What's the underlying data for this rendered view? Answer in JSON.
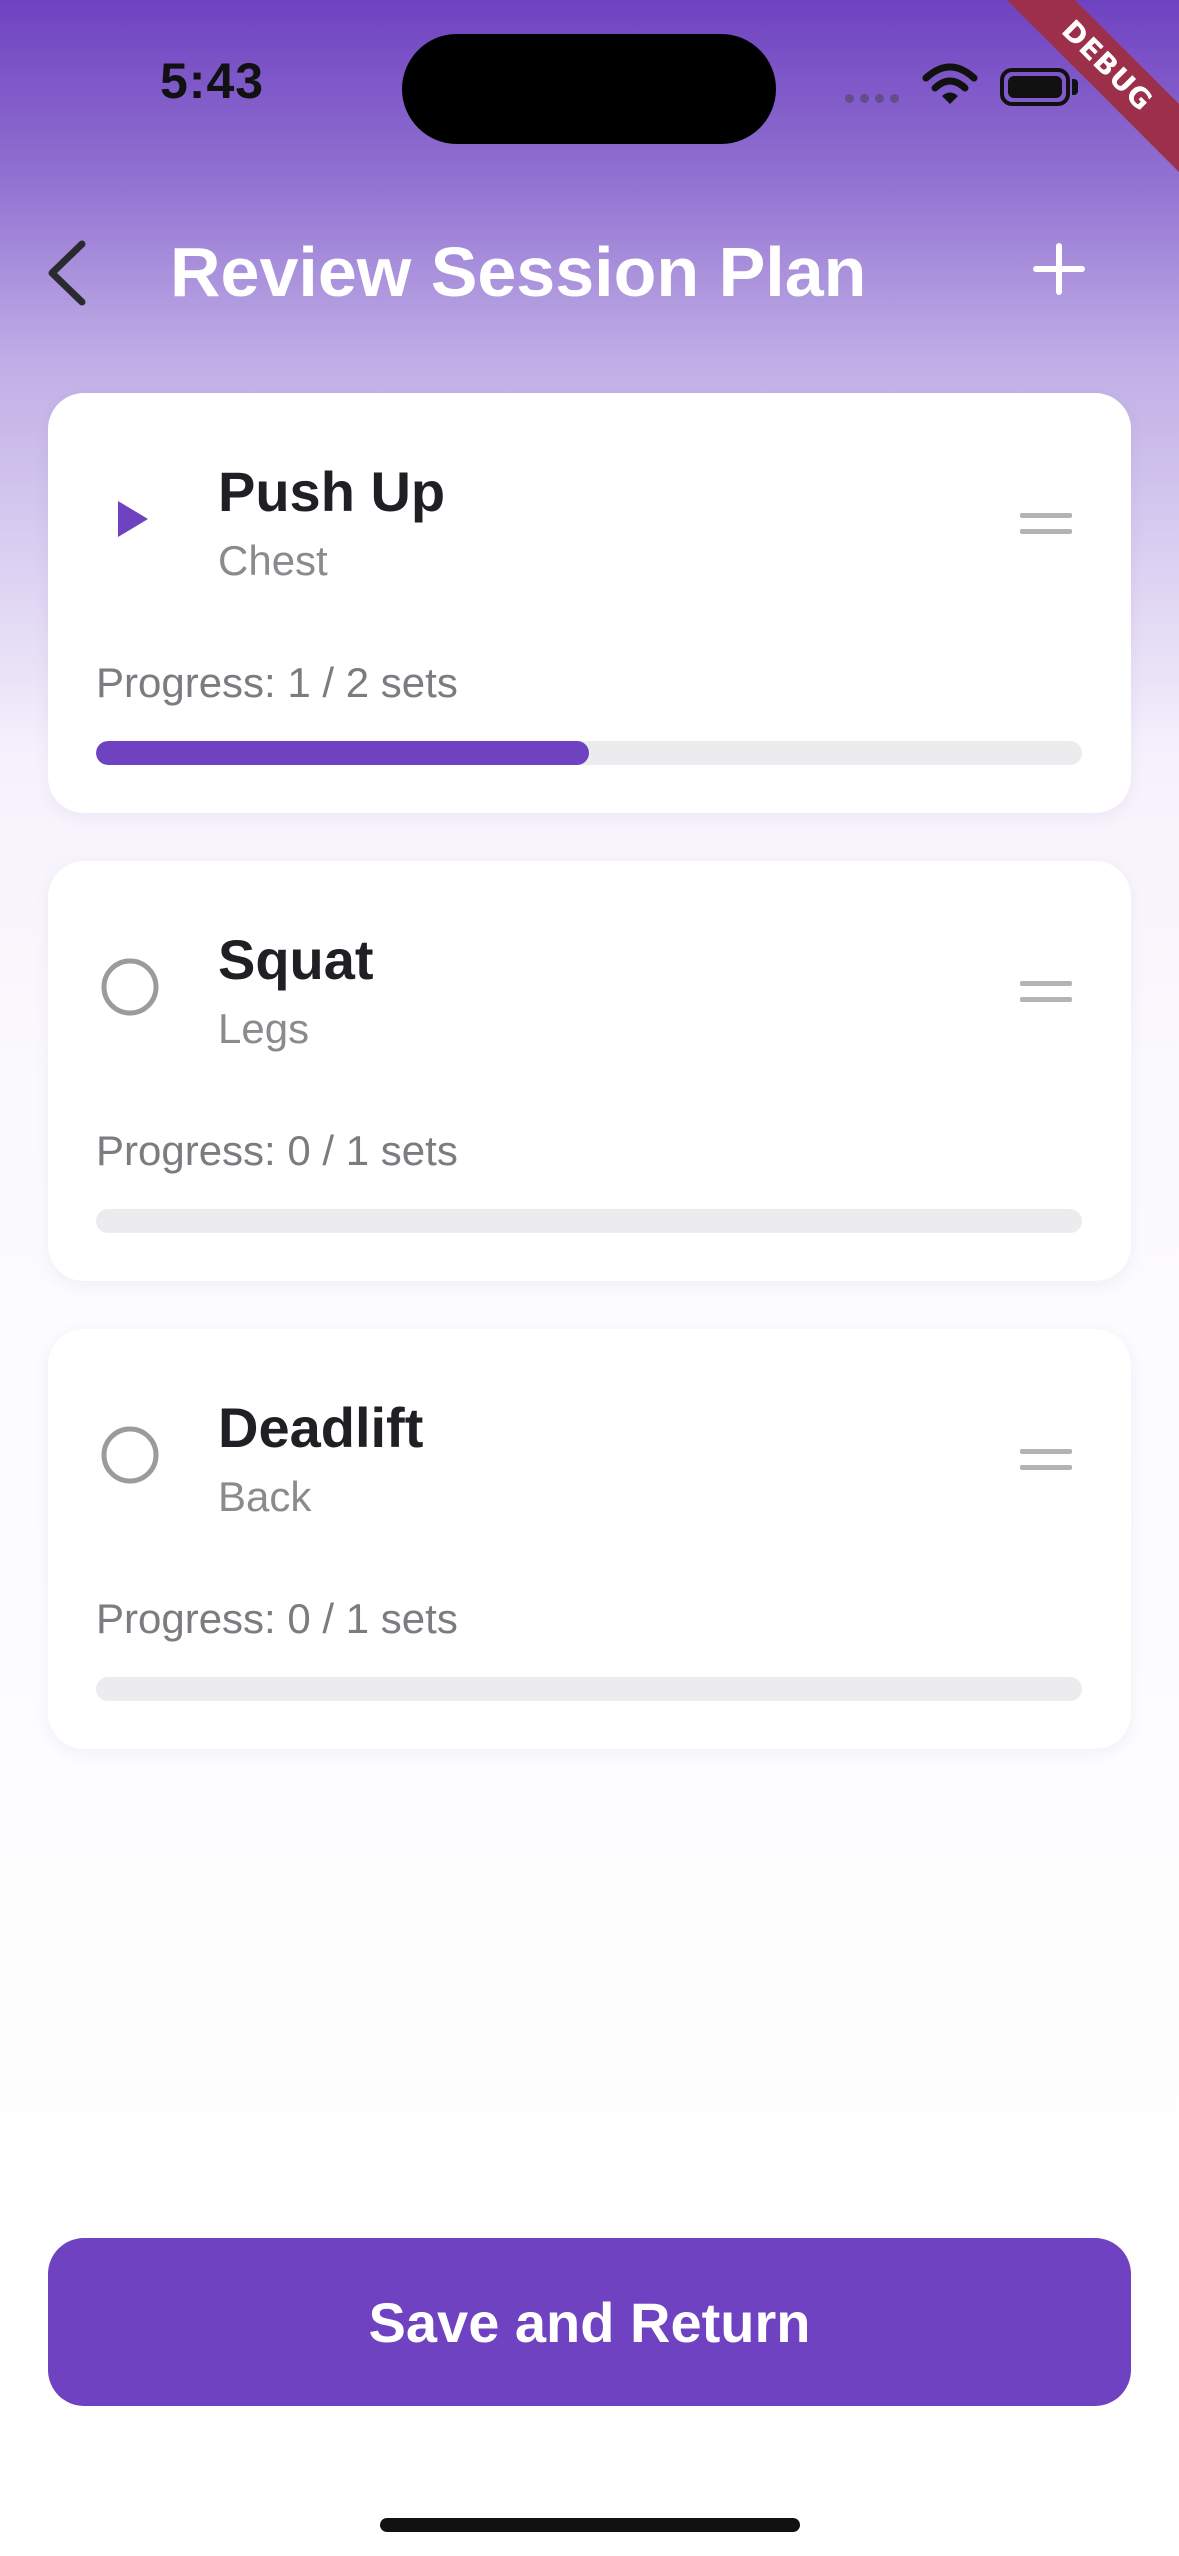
{
  "status_bar": {
    "time": "5:43",
    "debug_label": "DEBUG"
  },
  "header": {
    "title": "Review Session Plan",
    "back_icon": "chevron-left-icon",
    "add_icon": "plus-icon"
  },
  "exercises": [
    {
      "name": "Push Up",
      "group": "Chest",
      "progress_text": "Progress: 1 / 2 sets",
      "completed_sets": 1,
      "total_sets": 2,
      "status": "active",
      "status_icon": "play-icon"
    },
    {
      "name": "Squat",
      "group": "Legs",
      "progress_text": "Progress: 0 / 1 sets",
      "completed_sets": 0,
      "total_sets": 1,
      "status": "pending",
      "status_icon": "circle-icon"
    },
    {
      "name": "Deadlift",
      "group": "Back",
      "progress_text": "Progress: 0 / 1 sets",
      "completed_sets": 0,
      "total_sets": 1,
      "status": "pending",
      "status_icon": "circle-icon"
    }
  ],
  "footer": {
    "save_label": "Save and Return"
  },
  "colors": {
    "accent": "#6f42c1",
    "track": "#ececef",
    "debug_banner": "#9c2f4a"
  }
}
